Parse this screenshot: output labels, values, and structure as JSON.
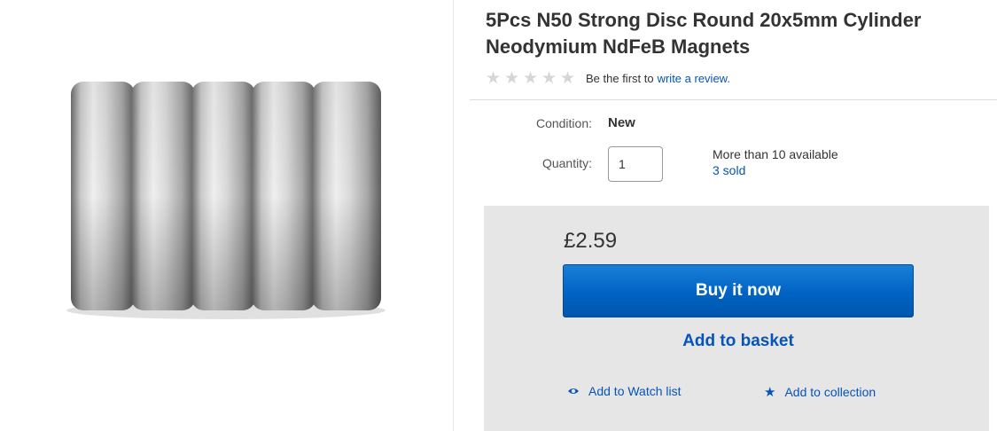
{
  "product": {
    "title": "5Pcs N50 Strong Disc Round 20x5mm Cylinder Neodymium NdFeB Magnets",
    "rating": {
      "stars": 0,
      "max": 5,
      "prompt": "Be the first to",
      "link": "write a review."
    },
    "condition": {
      "label": "Condition:",
      "value": "New"
    },
    "quantity": {
      "label": "Quantity:",
      "value": "1"
    },
    "availability": {
      "text": "More than 10 available",
      "sold": "3 sold"
    }
  },
  "buy_box": {
    "price": "£2.59",
    "buy_now": "Buy it now",
    "add_to_basket": "Add to basket",
    "watch": "Add to Watch list",
    "collection": "Add to collection"
  },
  "icons": {
    "star": "star-icon",
    "watch": "eye-icon",
    "collection": "star-icon"
  },
  "colors": {
    "link": "#0654ba",
    "button": "#0063c4",
    "buy_box_bg": "#e6e6e6"
  }
}
